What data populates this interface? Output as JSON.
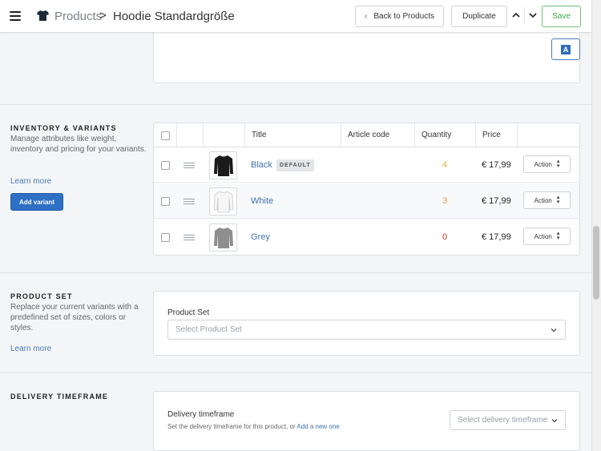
{
  "header": {
    "breadcrumb_root": "Products",
    "breadcrumb_separator": ">",
    "page_title": "Hoodie Standardgröße",
    "back_label": "Back to Products",
    "duplicate_label": "Duplicate",
    "save_label": "Save"
  },
  "inventory": {
    "title": "INVENTORY & VARIANTS",
    "description": "Manage attributes like weight, inventory and pricing for your variants.",
    "learn_more": "Learn more",
    "add_variant": "Add variant",
    "columns": [
      "Title",
      "Article code",
      "Quantity",
      "Price"
    ],
    "variants": [
      {
        "title": "Black",
        "badge": "DEFAULT",
        "quantity": "4",
        "quantity_color": "#e8a838",
        "price": "€ 17,99",
        "action": "Action",
        "swatch": "#1a1a1a"
      },
      {
        "title": "White",
        "badge": "",
        "quantity": "3",
        "quantity_color": "#e8a838",
        "price": "€ 17,99",
        "action": "Action",
        "swatch": "#f6f6f6"
      },
      {
        "title": "Grey",
        "badge": "",
        "quantity": "0",
        "quantity_color": "#c0392b",
        "price": "€ 17,99",
        "action": "Action",
        "swatch": "#8e8e8e"
      }
    ]
  },
  "product_set": {
    "title": "PRODUCT SET",
    "description": "Replace your current variants with a predefined set of sizes, colors or styles.",
    "learn_more": "Learn more",
    "field_label": "Product Set",
    "placeholder": "Select Product Set"
  },
  "delivery": {
    "title": "DELIVERY TIMEFRAME",
    "field_label": "Delivery timeframe",
    "help_text": "Set the delivery timeframe for this product, or",
    "help_link": "Add a new one",
    "placeholder": "Select delivery timeframe"
  },
  "colors": {
    "accent": "#2e70c4",
    "save_green": "#3ea84d",
    "link": "#3f72ab"
  }
}
